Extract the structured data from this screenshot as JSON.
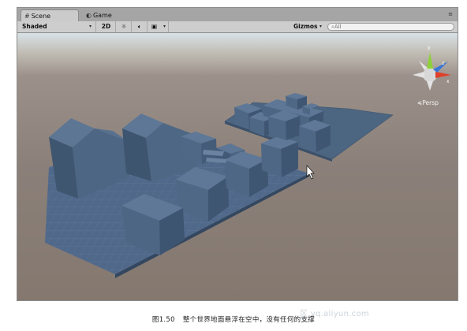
{
  "tabs": [
    {
      "label": "Scene",
      "icon": "grid-hash-icon",
      "active": true
    },
    {
      "label": "Game",
      "icon": "pacman-icon",
      "active": false
    }
  ],
  "toolbar": {
    "shading_mode": "Shaded",
    "mode_2d": "2D",
    "lighting_icon": "sun-icon",
    "audio_icon": "speaker-icon",
    "effects_icon": "image-icon",
    "gizmos_label": "Gizmos",
    "search_placeholder": "All",
    "search_icon": "magnifier-icon"
  },
  "viewport": {
    "projection_label": "Persp",
    "gizmo_axis_y": "y",
    "gizmo_axis_z": "z",
    "gizmo_axis_x": "x",
    "gizmo_colors": {
      "x": "#e0402a",
      "y": "#8fd13a",
      "z": "#3a76d6"
    },
    "ground_color": "#8a8078",
    "sky_color": "#c9d2d6",
    "mesh_color": "#4e6784"
  },
  "caption": {
    "number": "图1.50",
    "text": "整个世界地面悬浮在空中，没有任何的支撑"
  },
  "watermark": "区 yq.aliyun.com"
}
